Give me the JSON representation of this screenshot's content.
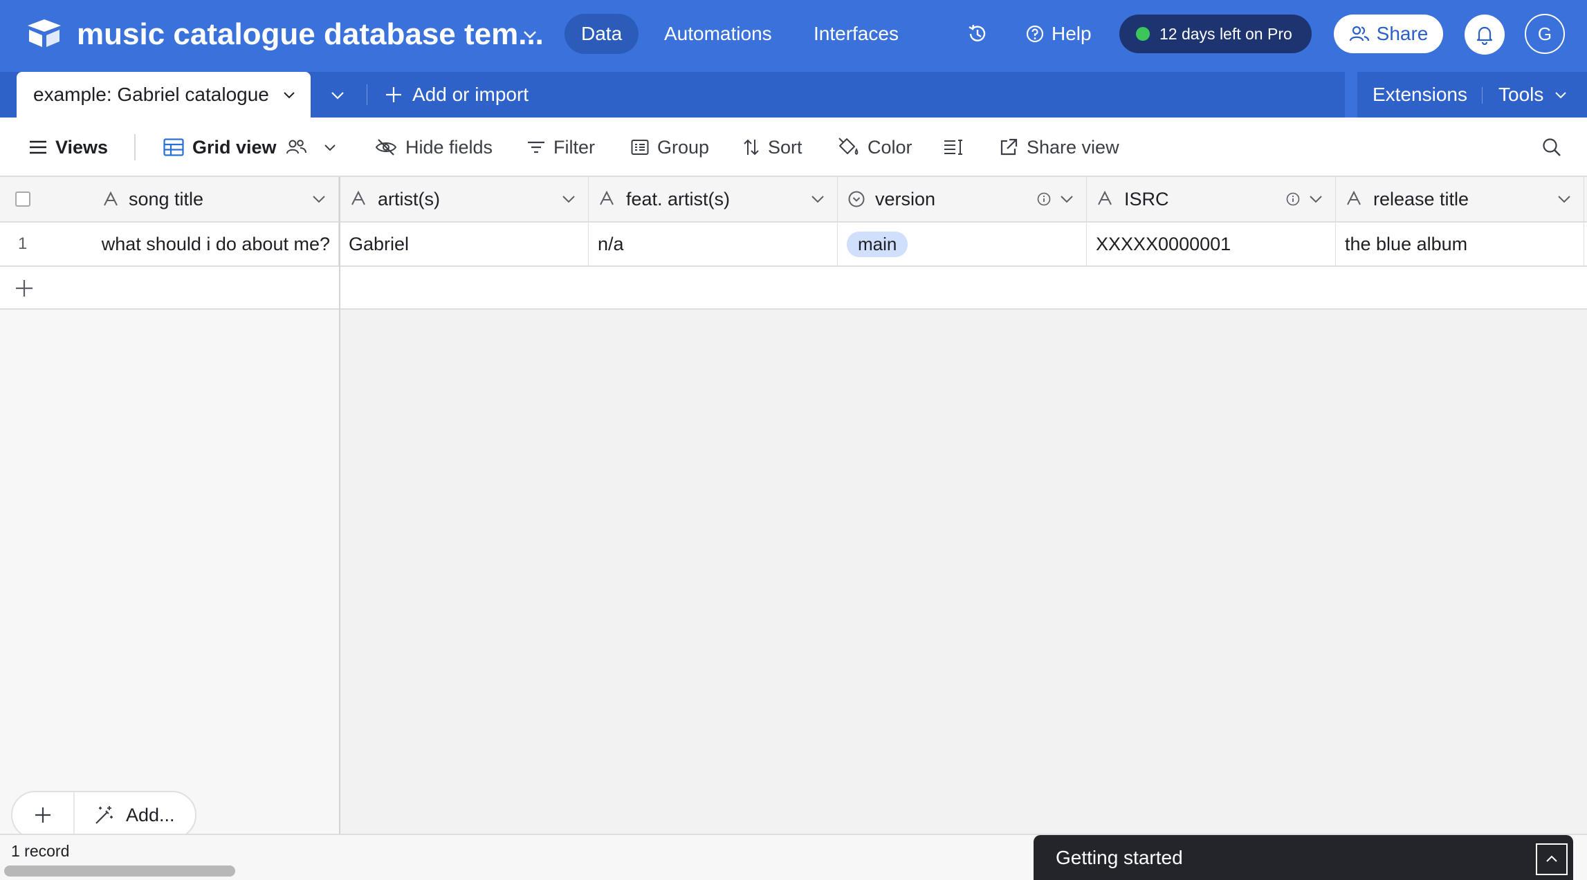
{
  "app": {
    "base_title": "music catalogue database tem...",
    "nav_tabs": [
      {
        "label": "Data",
        "active": true
      },
      {
        "label": "Automations",
        "active": false
      },
      {
        "label": "Interfaces",
        "active": false
      }
    ],
    "help_label": "Help",
    "pro_badge": "12 days left on Pro",
    "share_label": "Share",
    "avatar_initial": "G",
    "accent_color": "#3a71da",
    "icons": [
      "base-logo-icon",
      "chevron-down-icon",
      "history-icon",
      "help-icon",
      "share-people-icon",
      "bell-icon"
    ]
  },
  "tables": {
    "active_table": "example: Gabriel catalogue",
    "add_import_label": "Add or import",
    "extensions_label": "Extensions",
    "tools_label": "Tools"
  },
  "toolbar": {
    "views_label": "Views",
    "view_name": "Grid view",
    "hide_fields_label": "Hide fields",
    "filter_label": "Filter",
    "group_label": "Group",
    "sort_label": "Sort",
    "color_label": "Color",
    "share_view_label": "Share view"
  },
  "grid": {
    "columns": [
      {
        "label": "song title",
        "type_icon": "text-type-icon"
      },
      {
        "label": "artist(s)",
        "type_icon": "text-type-icon"
      },
      {
        "label": "feat. artist(s)",
        "type_icon": "text-type-icon"
      },
      {
        "label": "version",
        "type_icon": "single-select-type-icon"
      },
      {
        "label": "ISRC",
        "type_icon": "text-type-icon"
      },
      {
        "label": "release title",
        "type_icon": "text-type-icon"
      }
    ],
    "rows": [
      {
        "number": "1",
        "song_title": "what should i do about me?",
        "artists": "Gabriel",
        "feat_artists": "n/a",
        "version": "main",
        "isrc": "XXXXX0000001",
        "release_title": "the blue album"
      }
    ],
    "version_pill_color": "#cfdffc"
  },
  "footer": {
    "add_label": "Add...",
    "record_count": "1 record",
    "getting_started_label": "Getting started"
  }
}
